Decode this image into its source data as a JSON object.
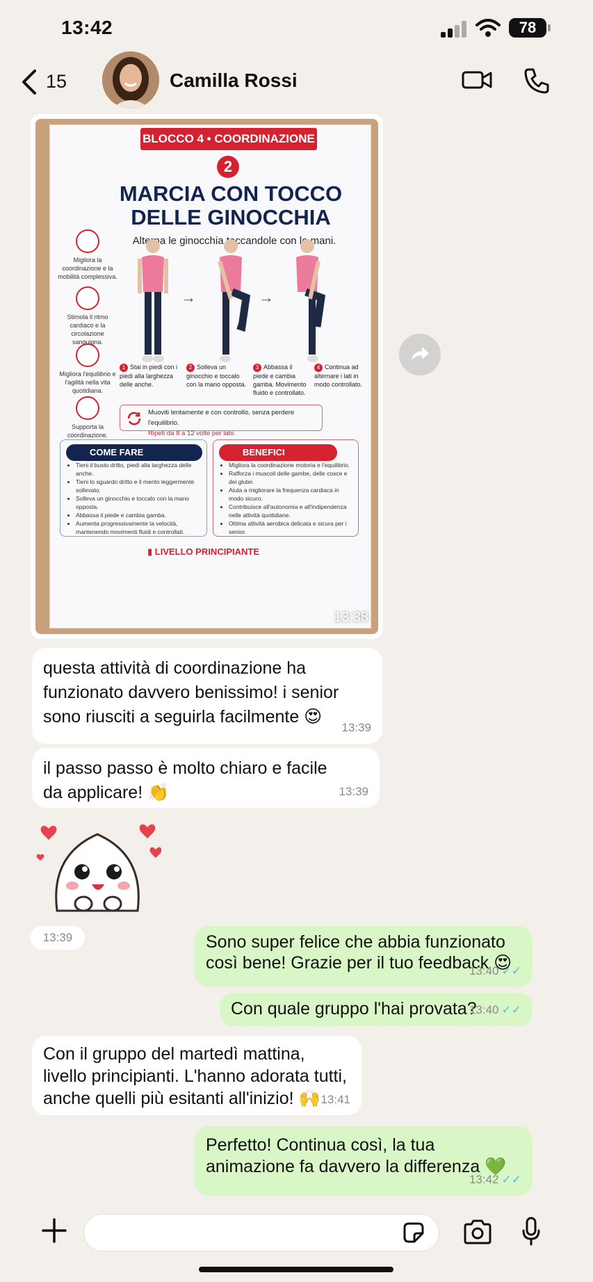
{
  "status_bar": {
    "time": "13:42",
    "battery": "78"
  },
  "header": {
    "back_count": "15",
    "contact_name": "Camilla Rossi"
  },
  "image_message": {
    "time": "13:38",
    "poster": {
      "block": "BLOCCO 4 • COORDINAZIONE",
      "number": "2",
      "title_line1": "MARCIA CON TOCCO",
      "title_line2": "DELLE GINOCCHIA",
      "subtitle": "Alterna le ginocchia toccandole con le mani.",
      "benefits_side": [
        "Migliora la coordinazione e la mobilità complessiva.",
        "Stimola il ritmo cardiaco e la circolazione sanguigna.",
        "Migliora l'equilibrio e l'agilità nella vita quotidiana.",
        "Supporta la coordinazione."
      ],
      "steps": [
        {
          "n": "1",
          "text": "Stai in piedi con i piedi alla larghezza delle anche."
        },
        {
          "n": "2",
          "text": "Solleva un ginocchio e toccalo con la mano opposta."
        },
        {
          "n": "3",
          "text": "Abbassa il piede e cambia gamba. Movimento fluido e controllato."
        },
        {
          "n": "4",
          "text": "Continua ad alternare i lati in modo controllato."
        }
      ],
      "note_line1": "Muoviti lentamente e con controllo, senza perdere l'equilibrio.",
      "note_line2": "Ripeti da 8 a 12 volte per lato.",
      "how_title": "COME FARE",
      "how_items": [
        "Tieni il busto dritto, piedi alla larghezza delle anche.",
        "Tieni lo sguardo dritto e il mento leggermente sollevato.",
        "Solleva un ginocchio e toccalo con la mano opposta.",
        "Abbassa il piede e cambia gamba.",
        "Aumenta progressivamente la velocità, mantenendo movimenti fluidi e controllati."
      ],
      "benefits_title": "BENEFICI",
      "benefits_items": [
        "Migliora la coordinazione motoria e l'equilibrio.",
        "Rafforza i muscoli delle gambe, delle cosce e dei glutei.",
        "Aiuta a migliorare la frequenza cardiaca in modo sicuro.",
        "Contribuisce all'autonomia e all'indipendenza nelle attività quotidiane.",
        "Ottima attività aerobica delicata e sicura per i senior."
      ],
      "level": "LIVELLO PRINCIPIANTE"
    }
  },
  "messages": [
    {
      "dir": "in",
      "line1": "questa attività di coordinazione ha",
      "line2": "funzionato davvero benissimo! i senior",
      "line3": "sono riusciti a seguirla facilmente 😍",
      "time": "13:39"
    },
    {
      "dir": "in",
      "line1": "il passo passo è molto chiaro e facile",
      "line2": "da applicare! 👏",
      "time": "13:39"
    },
    {
      "dir": "in",
      "sticker_time": "13:39"
    },
    {
      "dir": "out",
      "line1": "Sono super felice che abbia funzionato",
      "line2": "così bene! Grazie per il tuo feedback 😍",
      "time": "13:40"
    },
    {
      "dir": "out",
      "line1": "Con quale gruppo l'hai provata?",
      "time": "13:40"
    },
    {
      "dir": "in",
      "line1": "Con il gruppo del martedì mattina,",
      "line2": "livello principianti. L'hanno adorata tutti,",
      "line3": "anche quelli più esitanti all'inizio! 🙌",
      "time": "13:41"
    },
    {
      "dir": "out",
      "line1": "Perfetto! Continua così, la tua",
      "line2": "animazione fa davvero la differenza 💚",
      "time": "13:42"
    }
  ],
  "colors": {
    "outgoing_bubble": "#d8f6c6",
    "incoming_bubble": "#ffffff",
    "read_ticks": "#53bdeb",
    "poster_red": "#d42231",
    "poster_navy": "#13254f"
  }
}
